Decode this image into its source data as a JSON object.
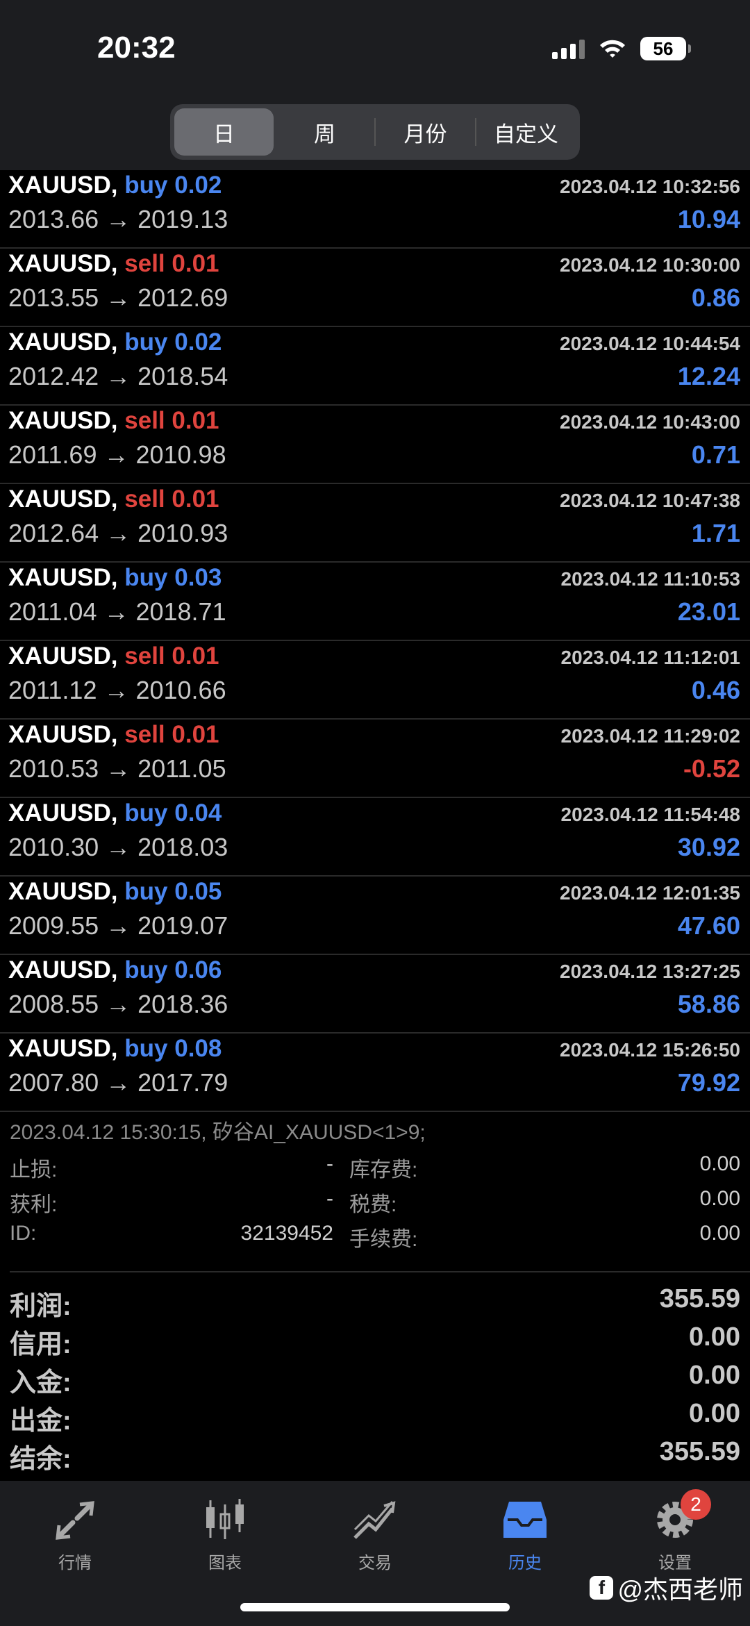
{
  "status": {
    "time": "20:32",
    "battery": "56"
  },
  "segments": [
    {
      "label": "日",
      "active": true
    },
    {
      "label": "周",
      "active": false
    },
    {
      "label": "月份",
      "active": false
    },
    {
      "label": "自定义",
      "active": false
    }
  ],
  "deals": [
    {
      "symbol": "XAUUSD,",
      "side": "buy",
      "volume": "0.02",
      "time": "2023.04.12 10:32:56",
      "prices": "2013.66 → 2019.13",
      "profit": "10.94"
    },
    {
      "symbol": "XAUUSD,",
      "side": "sell",
      "volume": "0.01",
      "time": "2023.04.12 10:30:00",
      "prices": "2013.55 → 2012.69",
      "profit": "0.86"
    },
    {
      "symbol": "XAUUSD,",
      "side": "buy",
      "volume": "0.02",
      "time": "2023.04.12 10:44:54",
      "prices": "2012.42 → 2018.54",
      "profit": "12.24"
    },
    {
      "symbol": "XAUUSD,",
      "side": "sell",
      "volume": "0.01",
      "time": "2023.04.12 10:43:00",
      "prices": "2011.69 → 2010.98",
      "profit": "0.71"
    },
    {
      "symbol": "XAUUSD,",
      "side": "sell",
      "volume": "0.01",
      "time": "2023.04.12 10:47:38",
      "prices": "2012.64 → 2010.93",
      "profit": "1.71"
    },
    {
      "symbol": "XAUUSD,",
      "side": "buy",
      "volume": "0.03",
      "time": "2023.04.12 11:10:53",
      "prices": "2011.04 → 2018.71",
      "profit": "23.01"
    },
    {
      "symbol": "XAUUSD,",
      "side": "sell",
      "volume": "0.01",
      "time": "2023.04.12 11:12:01",
      "prices": "2011.12 → 2010.66",
      "profit": "0.46"
    },
    {
      "symbol": "XAUUSD,",
      "side": "sell",
      "volume": "0.01",
      "time": "2023.04.12 11:29:02",
      "prices": "2010.53 → 2011.05",
      "profit": "-0.52"
    },
    {
      "symbol": "XAUUSD,",
      "side": "buy",
      "volume": "0.04",
      "time": "2023.04.12 11:54:48",
      "prices": "2010.30 → 2018.03",
      "profit": "30.92"
    },
    {
      "symbol": "XAUUSD,",
      "side": "buy",
      "volume": "0.05",
      "time": "2023.04.12 12:01:35",
      "prices": "2009.55 → 2019.07",
      "profit": "47.60"
    },
    {
      "symbol": "XAUUSD,",
      "side": "buy",
      "volume": "0.06",
      "time": "2023.04.12 13:27:25",
      "prices": "2008.55 → 2018.36",
      "profit": "58.86"
    },
    {
      "symbol": "XAUUSD,",
      "side": "buy",
      "volume": "0.08",
      "time": "2023.04.12 15:26:50",
      "prices": "2007.80 → 2017.79",
      "profit": "79.92"
    }
  ],
  "order_info": "2023.04.12 15:30:15, 矽谷AI_XAUUSD<1>9;",
  "details": [
    {
      "label1": "止损:",
      "value1": "-",
      "label2": "库存费:",
      "value2": "0.00"
    },
    {
      "label1": "获利:",
      "value1": "-",
      "label2": "税费:",
      "value2": "0.00"
    },
    {
      "label1": "ID:",
      "value1": "32139452",
      "label2": "手续费:",
      "value2": "0.00"
    }
  ],
  "summary": [
    {
      "label": "利润:",
      "value": "355.59"
    },
    {
      "label": "信用:",
      "value": "0.00"
    },
    {
      "label": "入金:",
      "value": "0.00"
    },
    {
      "label": "出金:",
      "value": "0.00"
    },
    {
      "label": "结余:",
      "value": "355.59"
    }
  ],
  "tabs": [
    {
      "label": "行情",
      "icon": "quotes-icon",
      "active": false
    },
    {
      "label": "图表",
      "icon": "chart-candles-icon",
      "active": false
    },
    {
      "label": "交易",
      "icon": "trade-icon",
      "active": false
    },
    {
      "label": "历史",
      "icon": "history-inbox-icon",
      "active": true
    },
    {
      "label": "设置",
      "icon": "gear-icon",
      "active": false,
      "badge": "2"
    }
  ],
  "watermark": "@杰西老师",
  "colors": {
    "buy": "#4a86f0",
    "sell": "#e0443e",
    "active_tab": "#4a86f0",
    "background": "#000000",
    "bar": "#1c1d20"
  }
}
